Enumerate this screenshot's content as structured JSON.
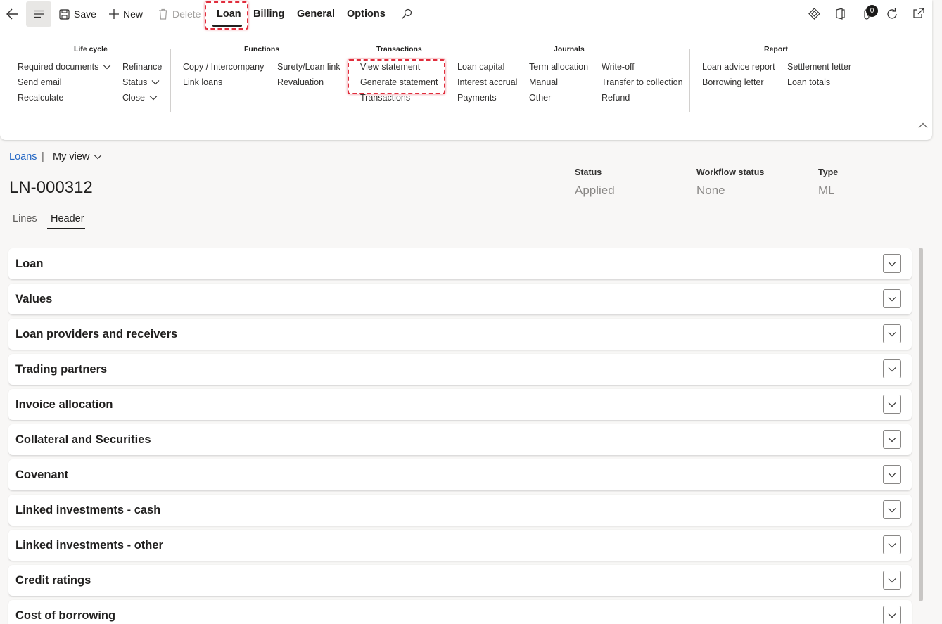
{
  "toolbar": {
    "save_label": "Save",
    "new_label": "New",
    "delete_label": "Delete",
    "tabs": [
      "Loan",
      "Billing",
      "General",
      "Options"
    ],
    "notification_count": "0"
  },
  "ribbon": {
    "groups": [
      {
        "title": "Life cycle"
      },
      {
        "title": "Functions"
      },
      {
        "title": "Transactions"
      },
      {
        "title": "Journals"
      },
      {
        "title": "Report"
      }
    ],
    "lifecycle": {
      "required_documents": "Required documents",
      "send_email": "Send email",
      "recalculate": "Recalculate",
      "refinance": "Refinance",
      "status": "Status",
      "close": "Close"
    },
    "functions": {
      "copy_intercompany": "Copy / Intercompany",
      "link_loans": "Link loans",
      "surety_loan_link": "Surety/Loan link",
      "revaluation": "Revaluation"
    },
    "transactions": {
      "view_statement": "View statement",
      "generate_statement": "Generate statement",
      "transactions": "Transactions"
    },
    "journals": {
      "loan_capital": "Loan capital",
      "interest_accrual": "Interest accrual",
      "payments": "Payments",
      "term_allocation": "Term allocation",
      "manual": "Manual",
      "other": "Other",
      "write_off": "Write-off",
      "transfer_to_collection": "Transfer to collection",
      "refund": "Refund"
    },
    "report": {
      "loan_advice_report": "Loan advice report",
      "borrowing_letter": "Borrowing letter",
      "settlement_letter": "Settlement letter",
      "loan_totals": "Loan totals"
    }
  },
  "breadcrumb": {
    "link": "Loans",
    "separator": "|",
    "view": "My view"
  },
  "record": {
    "id": "LN-000312"
  },
  "header_fields": [
    {
      "label": "Status",
      "value": "Applied"
    },
    {
      "label": "Workflow status",
      "value": "None"
    },
    {
      "label": "Type",
      "value": "ML"
    }
  ],
  "page_tabs": [
    "Lines",
    "Header"
  ],
  "sections": [
    "Loan",
    "Values",
    "Loan providers and receivers",
    "Trading partners",
    "Invoice allocation",
    "Collateral and Securities",
    "Covenant",
    "Linked investments - cash",
    "Linked investments - other",
    "Credit ratings",
    "Cost of borrowing"
  ]
}
